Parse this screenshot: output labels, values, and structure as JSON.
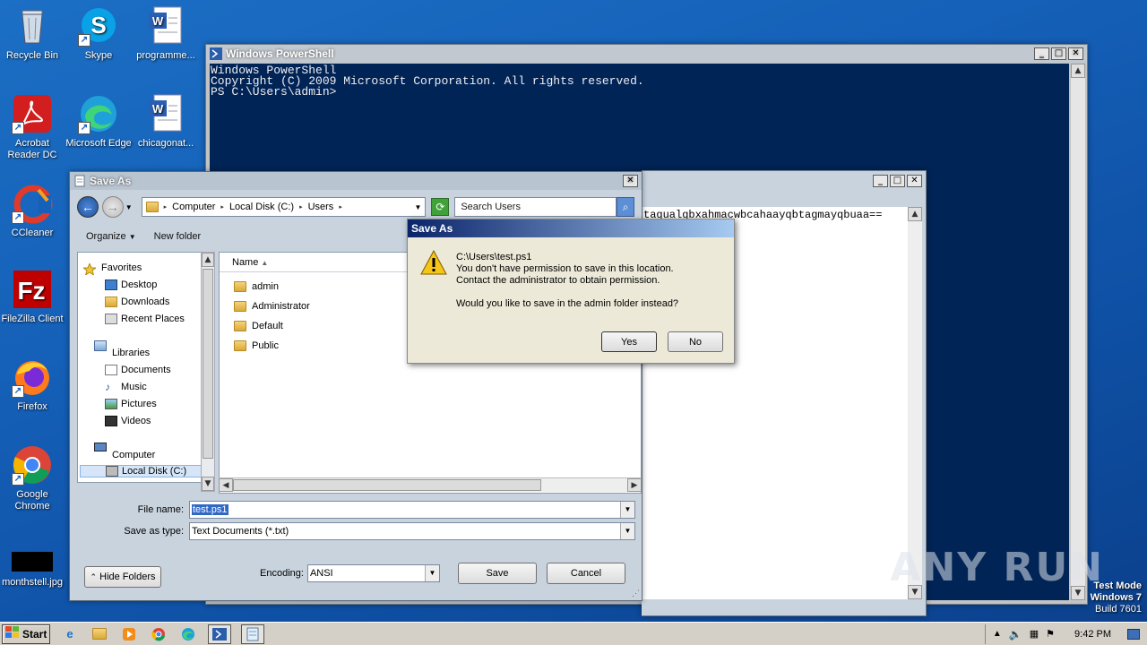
{
  "desktop": {
    "icons": [
      {
        "label": "Recycle Bin"
      },
      {
        "label": "Skype"
      },
      {
        "label": "programme..."
      },
      {
        "label": "Acrobat Reader DC"
      },
      {
        "label": "Microsoft Edge"
      },
      {
        "label": "chicagonat..."
      },
      {
        "label": "CCleaner"
      },
      {
        "label": "FileZilla Client"
      },
      {
        "label": "Firefox"
      },
      {
        "label": "Google Chrome"
      },
      {
        "label": "monthstell.jpg"
      }
    ],
    "watermark": "ANY RUN",
    "mode": {
      "line1": "Test Mode",
      "line2": "Windows 7",
      "line3": "Build 7601"
    }
  },
  "powershell": {
    "title": "Windows PowerShell",
    "lines": [
      "Windows PowerShell",
      "Copyright (C) 2009 Microsoft Corporation. All rights reserved.",
      "",
      "PS C:\\Users\\admin>"
    ]
  },
  "notepad": {
    "text": "tagualgbxahmacwbcahaayqbtagmayqbuaa=="
  },
  "saveas": {
    "title": "Save As",
    "path": [
      "Computer",
      "Local Disk (C:)",
      "Users"
    ],
    "search_placeholder": "Search Users",
    "organize": "Organize",
    "new_folder": "New folder",
    "nav": {
      "favorites": "Favorites",
      "fav_items": [
        "Desktop",
        "Downloads",
        "Recent Places"
      ],
      "libraries": "Libraries",
      "lib_items": [
        "Documents",
        "Music",
        "Pictures",
        "Videos"
      ],
      "computer": "Computer",
      "comp_items": [
        "Local Disk (C:)"
      ]
    },
    "column_name": "Name",
    "files": [
      "admin",
      "Administrator",
      "Default",
      "Public"
    ],
    "filename_label": "File name:",
    "filename": "test.ps1",
    "savetype_label": "Save as type:",
    "savetype": "Text Documents (*.txt)",
    "hide_folders": "Hide Folders",
    "encoding_label": "Encoding:",
    "encoding": "ANSI",
    "save": "Save",
    "cancel": "Cancel"
  },
  "error": {
    "title": "Save As",
    "line1": "C:\\Users\\test.ps1",
    "line2": "You don't have permission to save in this location.",
    "line3": "Contact the administrator to obtain permission.",
    "line4": "Would you like to save in the admin folder instead?",
    "yes": "Yes",
    "no": "No"
  },
  "taskbar": {
    "start": "Start",
    "time": "9:42 PM"
  }
}
